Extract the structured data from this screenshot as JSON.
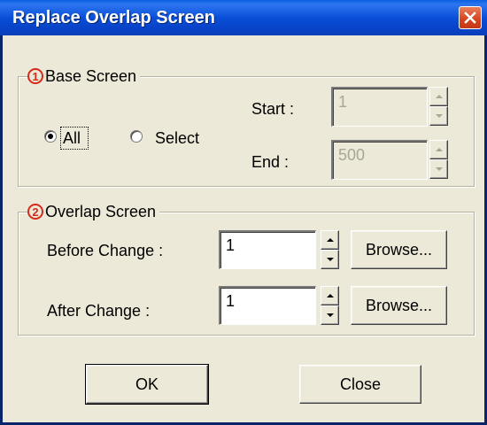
{
  "window": {
    "title": "Replace Overlap Screen"
  },
  "base_screen": {
    "number_marker": "1",
    "title": "Base Screen",
    "radio_all": "All",
    "radio_select": "Select",
    "selected": "All",
    "start_label": "Start :",
    "start_value": "1",
    "end_label": "End :",
    "end_value": "500"
  },
  "overlap_screen": {
    "number_marker": "2",
    "title": "Overlap Screen",
    "before_label": "Before Change :",
    "before_value": "1",
    "after_label": "After Change :",
    "after_value": "1",
    "browse_label": "Browse..."
  },
  "buttons": {
    "ok": "OK",
    "close": "Close"
  },
  "colors": {
    "title_bar": "#0A4FD8",
    "dialog_bg": "#ECE9D8",
    "marker_red": "#D62B1B"
  }
}
